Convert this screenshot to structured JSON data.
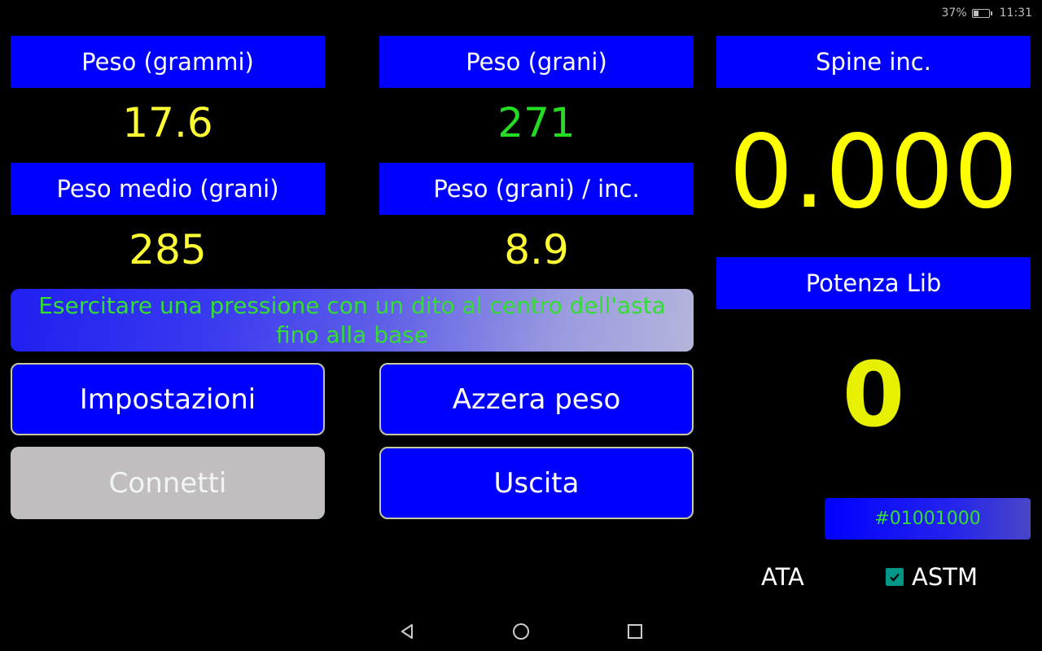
{
  "status_bar": {
    "battery_percent": "37%",
    "battery_level": 0.37,
    "time": "11:31"
  },
  "fields": {
    "weight_grams": {
      "label": "Peso (grammi)",
      "value": "17.6",
      "value_color": "#ffff33"
    },
    "weight_grains": {
      "label": "Peso (grani)",
      "value": "271",
      "value_color": "#22dd22"
    },
    "avg_weight_grains": {
      "label": "Peso medio (grani)",
      "value": "285",
      "value_color": "#ffff33"
    },
    "grains_per_inch": {
      "label": "Peso (grani) / inc.",
      "value": "8.9",
      "value_color": "#ffff33"
    },
    "spine": {
      "label": "Spine inc.",
      "value": "0.000"
    },
    "draw_weight": {
      "label": "Potenza Lib",
      "value": "0"
    }
  },
  "instruction": "Esercitare una pressione con un dito al centro dell'asta fino alla base",
  "buttons": {
    "settings": "Impostazioni",
    "tare": "Azzera peso",
    "connect": "Connetti",
    "exit": "Uscita"
  },
  "device_id": "#01001000",
  "standards": {
    "ata": {
      "label": "ATA",
      "checked": false
    },
    "astm": {
      "label": "ASTM",
      "checked": true
    }
  },
  "colors": {
    "label_bg": "#0000ff",
    "value_yellow": "#ffff33",
    "value_green": "#22dd22",
    "disabled_button": "#c0bebe",
    "checkbox": "#009688"
  },
  "navigation": {
    "back": "back-icon",
    "home": "home-icon",
    "recents": "recents-icon"
  }
}
